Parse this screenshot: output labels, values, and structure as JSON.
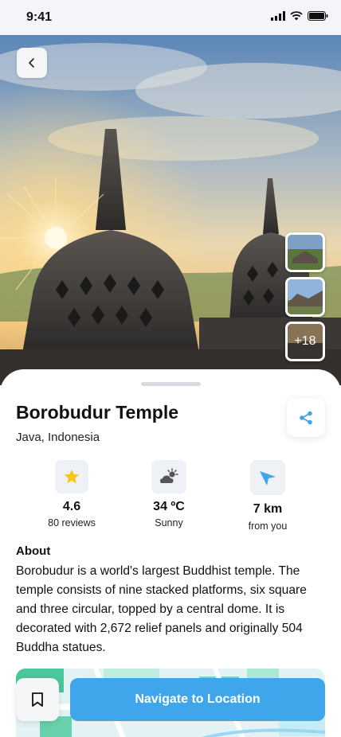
{
  "status_bar": {
    "time": "9:41",
    "icons": [
      "signal-icon",
      "wifi-icon",
      "battery-icon"
    ]
  },
  "hero": {
    "gallery_more_label": "+18"
  },
  "place": {
    "title": "Borobudur Temple",
    "location": "Java, Indonesia"
  },
  "stats": [
    {
      "icon": "star-icon",
      "value": "4.6",
      "sub": "80 reviews"
    },
    {
      "icon": "weather-icon",
      "value": "34 ºC",
      "sub": "Sunny"
    },
    {
      "icon": "navigation-arrow-icon",
      "value": "7 km",
      "sub": "from you"
    }
  ],
  "about": {
    "heading": "About",
    "text": "Borobudur is a world's largest Buddhist temple. The temple consists of nine stacked platforms, six square and three circular, topped by a central dome. It is decorated with 2,672 relief panels and originally 504 Buddha statues."
  },
  "actions": {
    "navigate_label": "Navigate to Location"
  },
  "colors": {
    "accent": "#3fa6eb",
    "star": "#f5c518",
    "surface": "#eef1f5"
  }
}
